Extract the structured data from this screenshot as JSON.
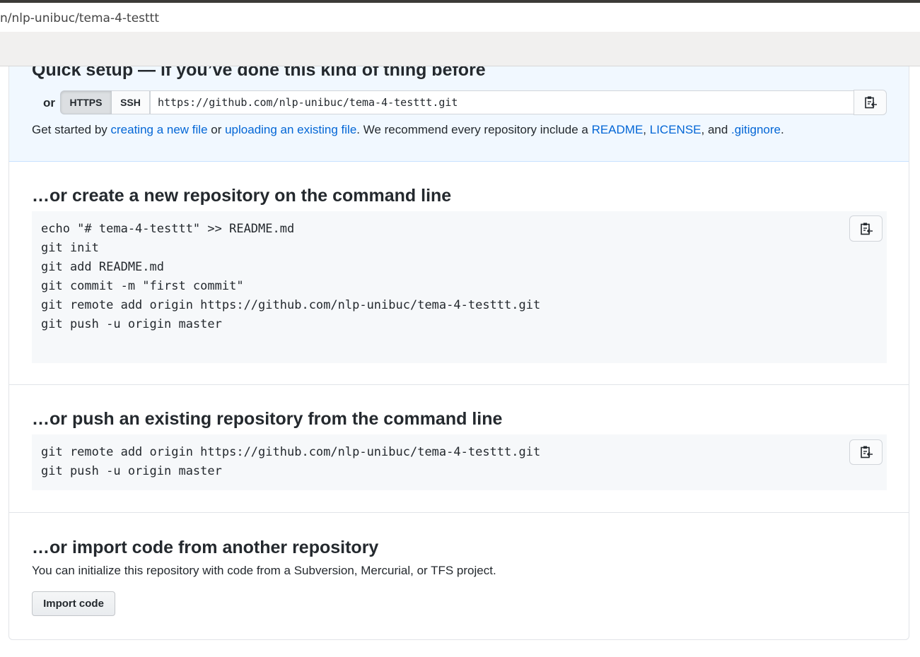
{
  "browser": {
    "url": "n/nlp-unibuc/tema-4-testtt"
  },
  "quick_setup": {
    "title": "Quick setup — if you’ve done this kind of thing before",
    "or_label": "or",
    "protocols": [
      "HTTPS",
      "SSH"
    ],
    "selected_protocol": "HTTPS",
    "clone_url": "https://github.com/nlp-unibuc/tema-4-testtt.git",
    "desc": {
      "p1": "Get started by ",
      "link_new_file": "creating a new file",
      "p2": " or ",
      "link_upload": "uploading an existing file",
      "p3": ". We recommend every repository include a ",
      "link_readme": "README",
      "p4": ", ",
      "link_license": "LICENSE",
      "p5": ", and ",
      "link_gitignore": ".gitignore",
      "p6": "."
    }
  },
  "new_repo": {
    "title": "…or create a new repository on the command line",
    "lines": [
      "echo \"# tema-4-testtt\" >> README.md",
      "git init",
      "git add README.md",
      "git commit -m \"first commit\"",
      "git remote add origin https://github.com/nlp-unibuc/tema-4-testtt.git",
      "git push -u origin master"
    ]
  },
  "push_existing": {
    "title": "…or push an existing repository from the command line",
    "lines": [
      "git remote add origin https://github.com/nlp-unibuc/tema-4-testtt.git",
      "git push -u origin master"
    ]
  },
  "import": {
    "title": "…or import code from another repository",
    "desc": "You can initialize this repository with code from a Subversion, Mercurial, or TFS project.",
    "button_label": "Import code"
  },
  "icons": {
    "copy": "clipboard-icon"
  },
  "colors": {
    "link": "#0366d6",
    "quick_setup_bg": "#f1f8ff",
    "code_bg": "#f6f8fa",
    "text": "#24292e"
  }
}
